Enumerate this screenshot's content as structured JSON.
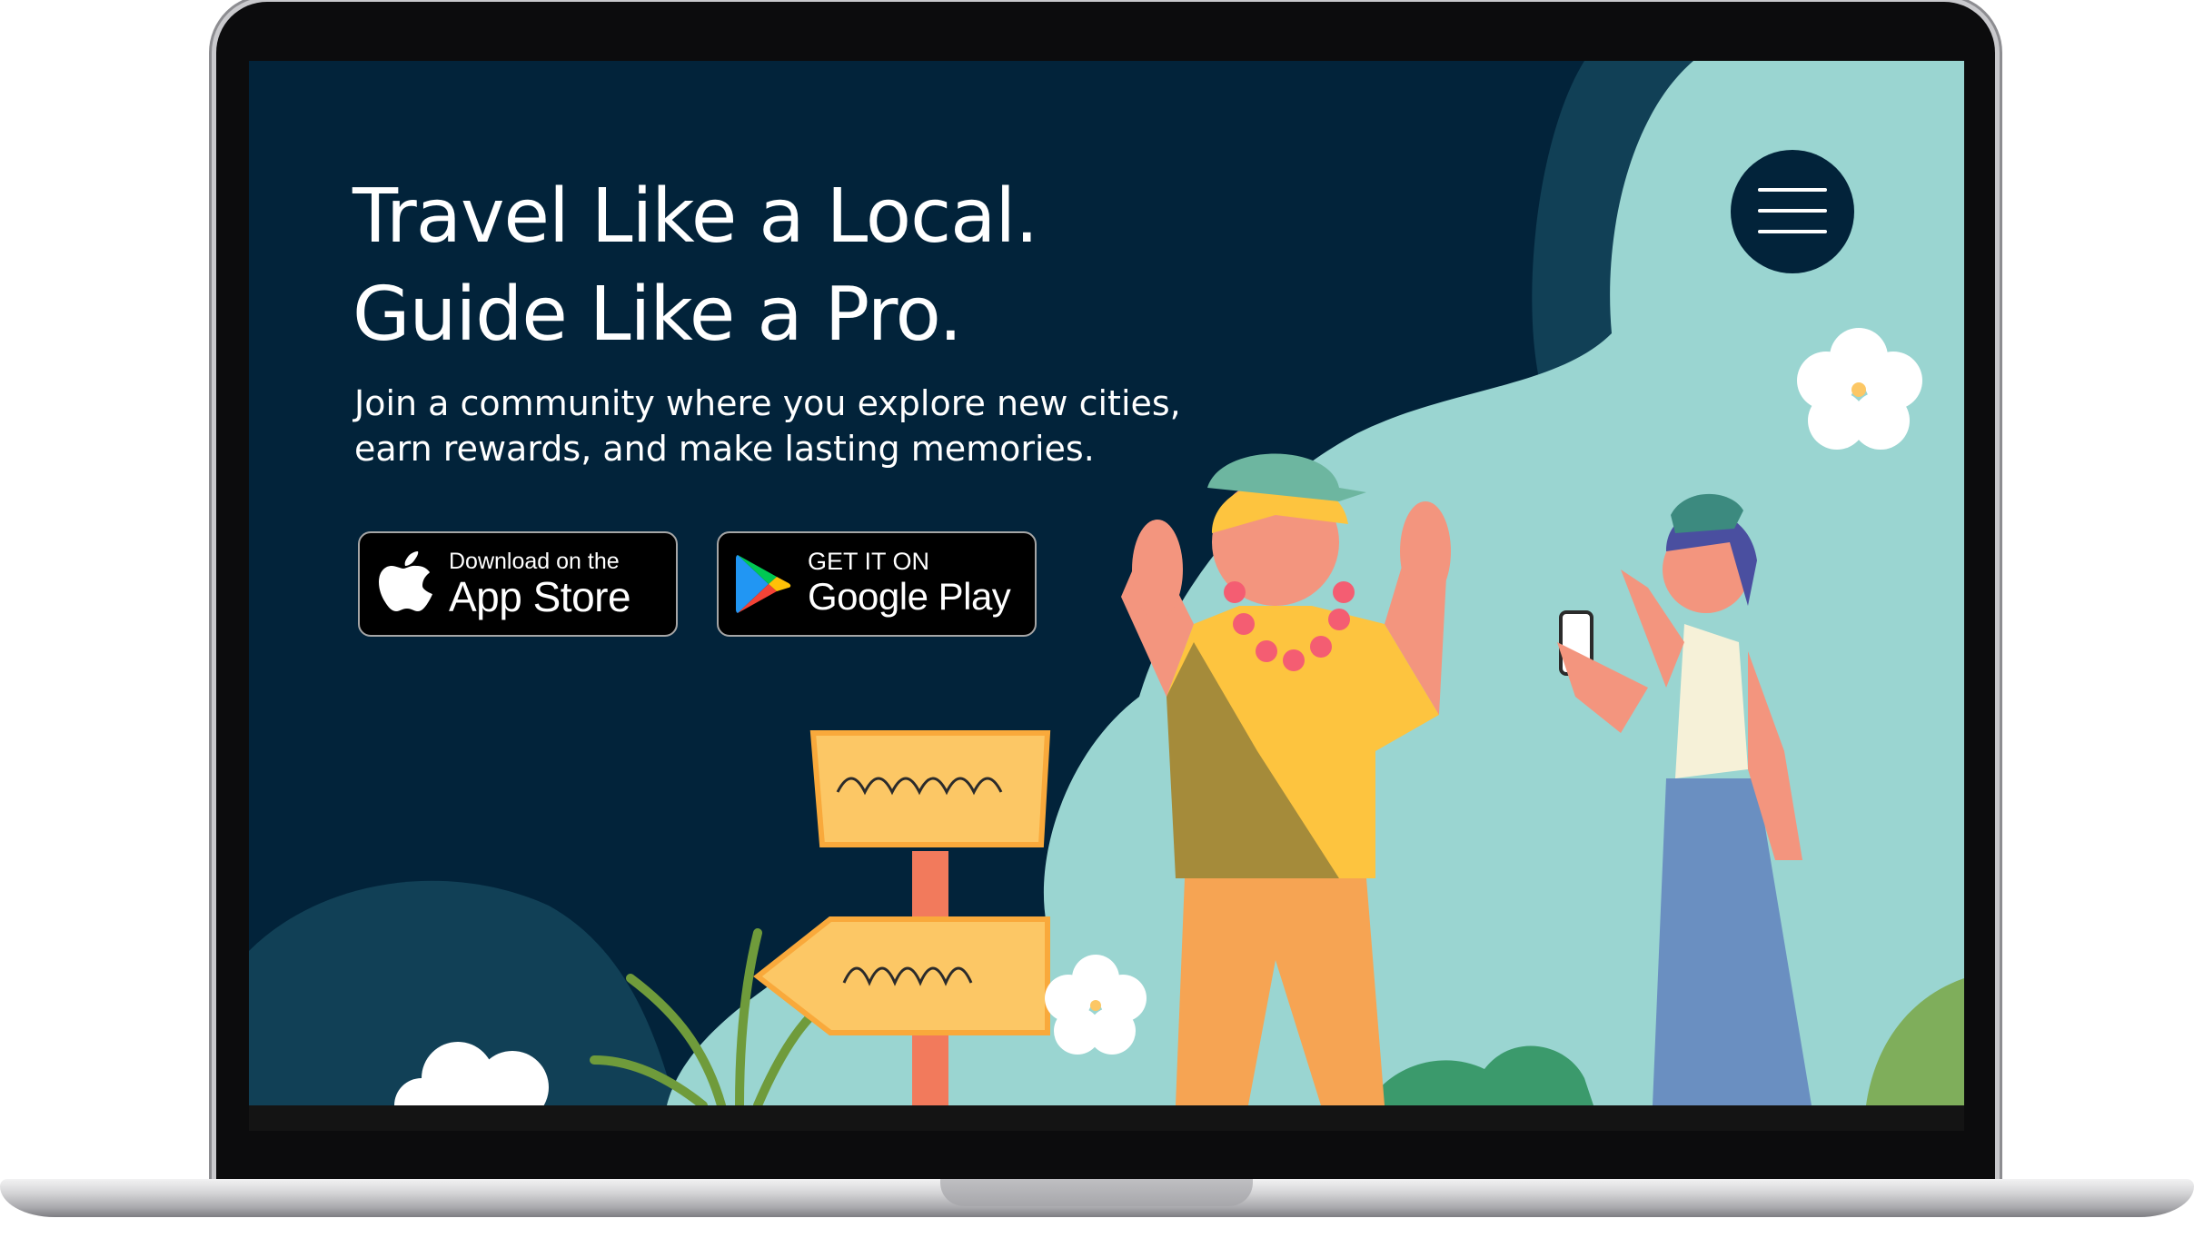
{
  "hero": {
    "title_line1": "Travel Like a Local.",
    "title_line2": "Guide Like a Pro.",
    "subtitle_line1": "Join a community where you explore new cities,",
    "subtitle_line2": "earn rewards, and make lasting memories."
  },
  "app_store": {
    "small_label": "Download on the",
    "big_label": "App Store",
    "icon": "apple-icon"
  },
  "google_play": {
    "small_label": "GET IT ON",
    "big_label": "Google Play",
    "icon": "google-play-icon"
  },
  "menu": {
    "icon": "hamburger-menu-icon"
  },
  "colors": {
    "background": "#02233a",
    "blob_light": "#9ad5d1",
    "blob_dark": "#114056",
    "sign_yellow": "#fcc765",
    "shirt_yellow": "#fdc43f",
    "skirt_blue": "#6a8fc1"
  }
}
